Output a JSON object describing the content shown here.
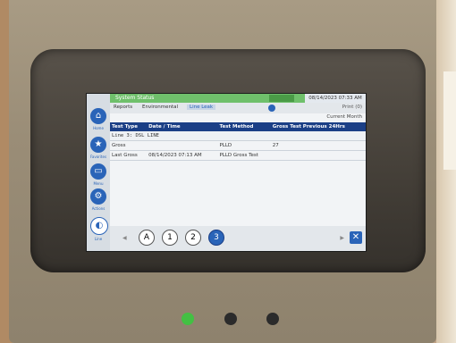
{
  "system": {
    "title": "System Status",
    "datetime": "08/14/2023 07:33 AM",
    "alarm_text": ""
  },
  "tabs": [
    {
      "label": "Reports"
    },
    {
      "label": "Environmental"
    },
    {
      "label": "Line Leak"
    }
  ],
  "toolbar": {
    "print_label": "Print (0)",
    "period_label": "Current Month"
  },
  "sidebar": {
    "items": [
      {
        "label": "Home",
        "icon": "home-icon"
      },
      {
        "label": "Favorites",
        "icon": "star-icon"
      },
      {
        "label": "Menu",
        "icon": "menu-icon"
      },
      {
        "label": "Actions",
        "icon": "actions-icon"
      },
      {
        "label": "Line",
        "icon": "line-icon"
      }
    ]
  },
  "table": {
    "headers": [
      "Test Type",
      "Date / Time",
      "Test Method",
      "Gross Test Previous 24Hrs"
    ],
    "group_label": "Line 3: DSL LINE",
    "rows": [
      [
        "Gross",
        "",
        "PLLD",
        "27"
      ],
      [
        "Last Gross",
        "08/14/2023 07:13 AM",
        "PLLD Gross Test",
        ""
      ]
    ]
  },
  "bottom": {
    "clock_labels": [
      "A",
      "1",
      "2",
      "3"
    ],
    "close_label": "✕"
  }
}
